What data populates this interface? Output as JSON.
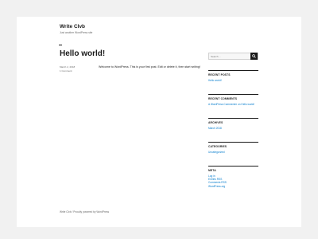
{
  "site": {
    "title": "Write Clvb",
    "description": "Just another WordPress site"
  },
  "post": {
    "title": "Hello world!",
    "date": "March 2, 2018",
    "comments": "1 Comment",
    "body": "Welcome to WordPress. This is your first post. Edit or delete it, then start writing!"
  },
  "search": {
    "placeholder": "Search …",
    "button_icon": "search-icon"
  },
  "widgets": {
    "recent_posts": {
      "title": "RECENT POSTS",
      "items": [
        "Hello world!"
      ]
    },
    "recent_comments": {
      "title": "RECENT COMMENTS",
      "items": [
        "A WordPress Commenter on Hello world!"
      ]
    },
    "archives": {
      "title": "ARCHIVES",
      "items": [
        "March 2018"
      ]
    },
    "categories": {
      "title": "CATEGORIES",
      "items": [
        "Uncategorized"
      ]
    },
    "meta": {
      "title": "META",
      "items": [
        "Log in",
        "Entries RSS",
        "Comments RSS",
        "WordPress.org"
      ]
    }
  },
  "footer": {
    "text": "Write Clvb / Proudly powered by WordPress"
  },
  "colors": {
    "link": "#007acc",
    "text": "#1a1a1a",
    "muted": "#686868",
    "background": "#f1f1f1"
  }
}
